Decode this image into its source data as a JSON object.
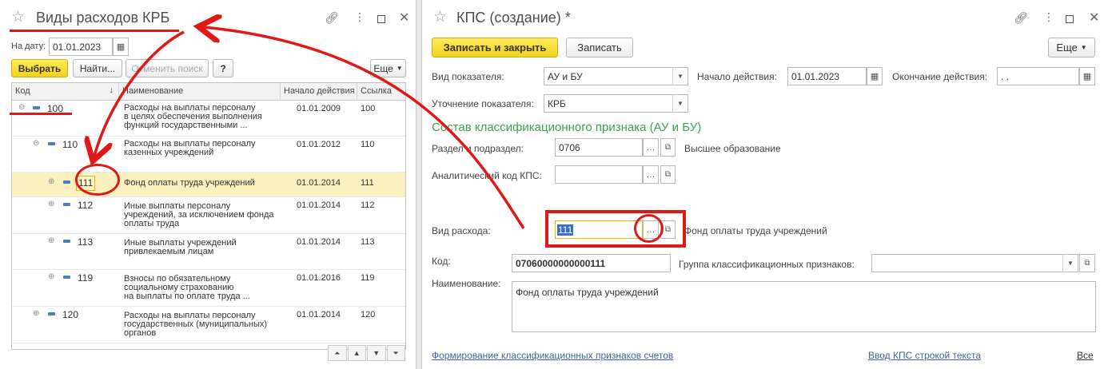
{
  "left": {
    "title": "Виды расходов КРБ",
    "date_label": "На дату:",
    "date_value": "01.01.2023",
    "buttons": {
      "select": "Выбрать",
      "find": "Найти...",
      "cancel_search": "Отменить поиск",
      "help": "?",
      "more": "Еще"
    },
    "columns": [
      "Код",
      "Наименование",
      "Начало действия",
      "Ссылка"
    ],
    "rows": [
      {
        "code": "100",
        "name": "Расходы на выплаты персоналу\nв целях обеспечения выполнения\nфункций государственными ...",
        "date": "01.01.2009",
        "ref": "100"
      },
      {
        "code": "110",
        "name": "Расходы на выплаты персоналу\nказенных учреждений",
        "date": "01.01.2012",
        "ref": "110"
      },
      {
        "code": "111",
        "name": "Фонд оплаты труда учреждений",
        "date": "01.01.2014",
        "ref": "111"
      },
      {
        "code": "112",
        "name": "Иные выплаты персоналу\nучреждений, за исключением фонда\nоплаты труда",
        "date": "01.01.2014",
        "ref": "112"
      },
      {
        "code": "113",
        "name": "Иные выплаты учреждений\nпривлекаемым лицам",
        "date": "01.01.2014",
        "ref": "113"
      },
      {
        "code": "119",
        "name": "Взносы по обязательному\nсоциальному страхованию\nна выплаты по оплате труда ...",
        "date": "01.01.2016",
        "ref": "119"
      },
      {
        "code": "120",
        "name": "Расходы на выплаты персоналу\nгосударственных (муниципальных)\nорганов",
        "date": "01.01.2014",
        "ref": "120"
      }
    ]
  },
  "right": {
    "title": "КПС (создание) *",
    "buttons": {
      "save_close": "Записать и закрыть",
      "save": "Записать",
      "more": "Еще"
    },
    "indicator_type_label": "Вид показателя:",
    "indicator_type_value": "АУ и БУ",
    "start_label": "Начало действия:",
    "start_value": "01.01.2023",
    "end_label": "Окончание действия:",
    "end_value": " .  .",
    "refine_label": "Уточнение показателя:",
    "refine_value": "КРБ",
    "section_title": "Состав классификационного признака (АУ и БУ)",
    "razdel_label": "Раздел и подраздел:",
    "razdel_value": "0706",
    "razdel_desc": "Высшее образование",
    "analytic_label": "Аналитический код КПС:",
    "analytic_value": "",
    "expense_label": "Вид расхода:",
    "expense_value": "111",
    "expense_desc": "Фонд оплаты труда учреждений",
    "code_label": "Код:",
    "code_value": "07060000000000111",
    "group_label": "Группа классификационных признаков:",
    "group_value": "",
    "name_label": "Наименование:",
    "name_value": "Фонд оплаты труда учреждений",
    "link_forming": "Формирование классификационных признаков счетов",
    "link_input": "Ввод КПС строкой текста",
    "link_all": "Все"
  },
  "colors": {
    "accent_yellow": "#f2d21b",
    "annotation_red": "#e01818",
    "green_header": "#3ca24a",
    "link_blue": "#3c63a7"
  }
}
